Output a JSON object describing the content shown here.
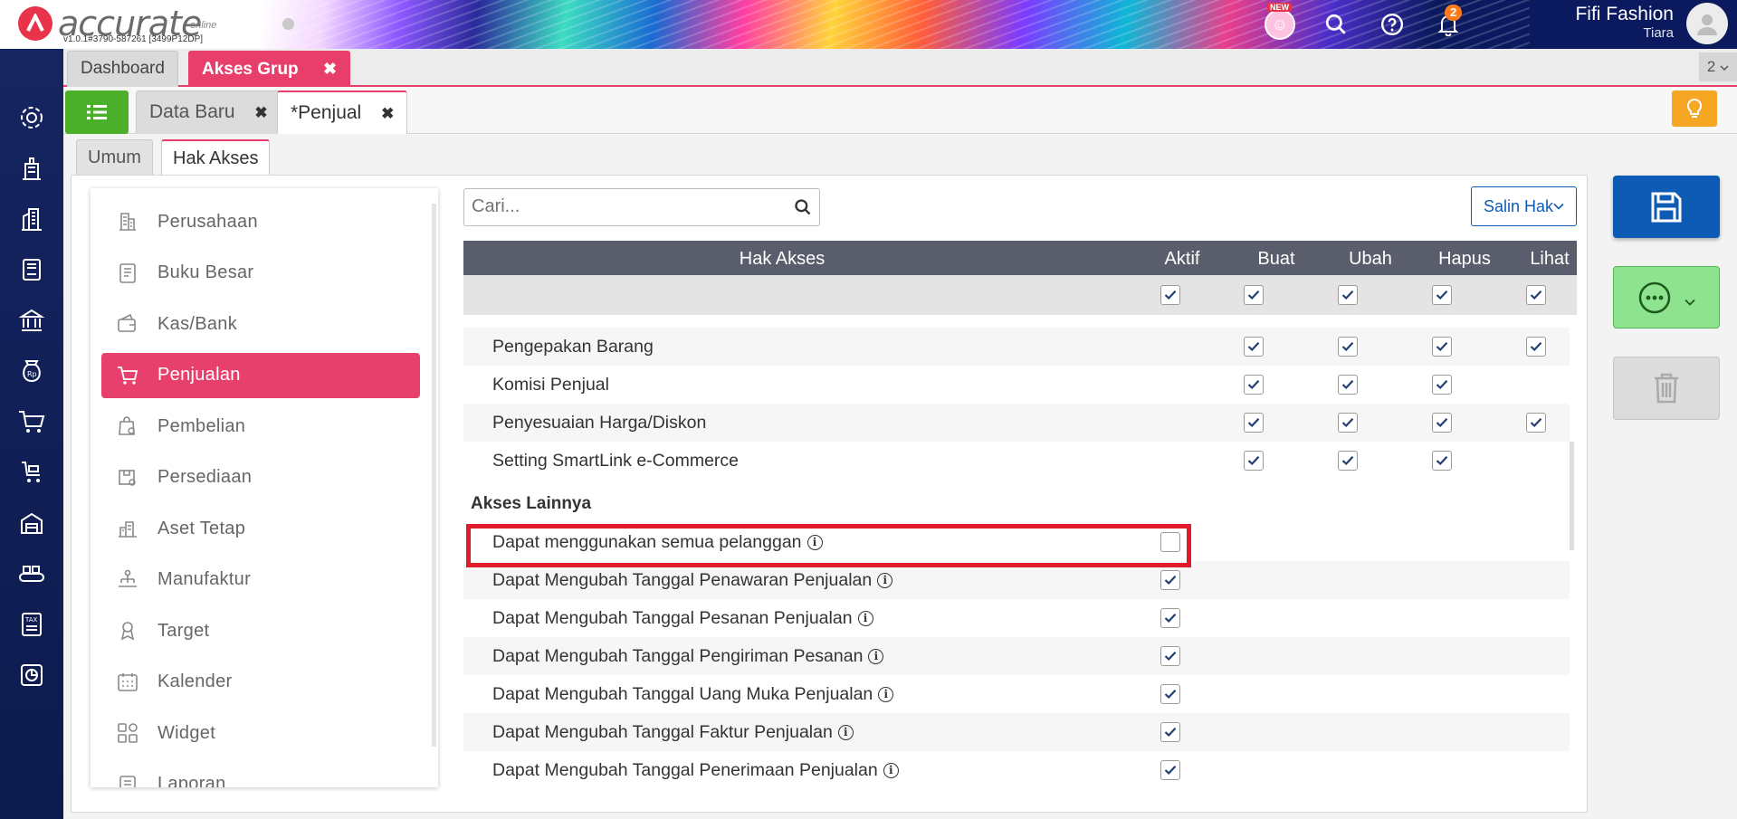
{
  "app": {
    "brand": "accurate",
    "brand_suffix": "online",
    "version": "v1.0.1#3790-587261 [3499P12DP]",
    "new_badge": "NEW",
    "notif_count": "2",
    "company": "Fifi Fashion",
    "user": "Tiara",
    "page_count": "2"
  },
  "tabs_main": [
    {
      "label": "Dashboard"
    },
    {
      "label": "Akses Grup",
      "close": "✖"
    }
  ],
  "tabs_doc": [
    {
      "label": "Data Baru",
      "close": "✖"
    },
    {
      "label": "*Penjual",
      "close": "✖"
    }
  ],
  "tabs_form": [
    {
      "label": "Umum"
    },
    {
      "label": "Hak Akses"
    }
  ],
  "categories": [
    {
      "label": "Perusahaan",
      "icon": "building-icon"
    },
    {
      "label": "Buku Besar",
      "icon": "ledger-icon"
    },
    {
      "label": "Kas/Bank",
      "icon": "wallet-icon"
    },
    {
      "label": "Penjualan",
      "icon": "cart-icon"
    },
    {
      "label": "Pembelian",
      "icon": "bag-icon"
    },
    {
      "label": "Persediaan",
      "icon": "box-icon"
    },
    {
      "label": "Aset Tetap",
      "icon": "asset-icon"
    },
    {
      "label": "Manufaktur",
      "icon": "factory-icon"
    },
    {
      "label": "Target",
      "icon": "target-icon"
    },
    {
      "label": "Kalender",
      "icon": "calendar-icon"
    },
    {
      "label": "Widget",
      "icon": "widget-icon"
    },
    {
      "label": "Laporan",
      "icon": "report-icon"
    }
  ],
  "search": {
    "placeholder": "Cari..."
  },
  "copy_button": "Salin Hak",
  "grid": {
    "columns": [
      "Hak Akses",
      "Aktif",
      "Buat",
      "Ubah",
      "Hapus",
      "Lihat"
    ],
    "section_other": "Akses Lainnya",
    "info_glyph": "i",
    "rows": [
      {
        "label": "Pengepakan Barang",
        "buat": true,
        "ubah": true,
        "hapus": true,
        "lihat": true
      },
      {
        "label": "Komisi Penjual",
        "buat": true,
        "ubah": true,
        "hapus": true
      },
      {
        "label": "Penyesuaian Harga/Diskon",
        "buat": true,
        "ubah": true,
        "hapus": true,
        "lihat": true
      },
      {
        "label": "Setting SmartLink e-Commerce",
        "buat": true,
        "ubah": true,
        "hapus": true
      }
    ],
    "other_rows": [
      {
        "label": "Dapat menggunakan semua pelanggan",
        "aktif": false
      },
      {
        "label": "Dapat Mengubah Tanggal Penawaran Penjualan",
        "aktif": true
      },
      {
        "label": "Dapat Mengubah Tanggal Pesanan Penjualan",
        "aktif": true
      },
      {
        "label": "Dapat Mengubah Tanggal Pengiriman Pesanan",
        "aktif": true
      },
      {
        "label": "Dapat Mengubah Tanggal Uang Muka Penjualan",
        "aktif": true
      },
      {
        "label": "Dapat Mengubah Tanggal Faktur Penjualan",
        "aktif": true
      },
      {
        "label": "Dapat Mengubah Tanggal Penerimaan Penjualan",
        "aktif": true
      }
    ]
  },
  "colors": {
    "accent": "#e8406c",
    "primary": "#0e5bb5",
    "success": "#4caf29",
    "highlight": "#e11b2a",
    "sidebar": "#13215a"
  }
}
